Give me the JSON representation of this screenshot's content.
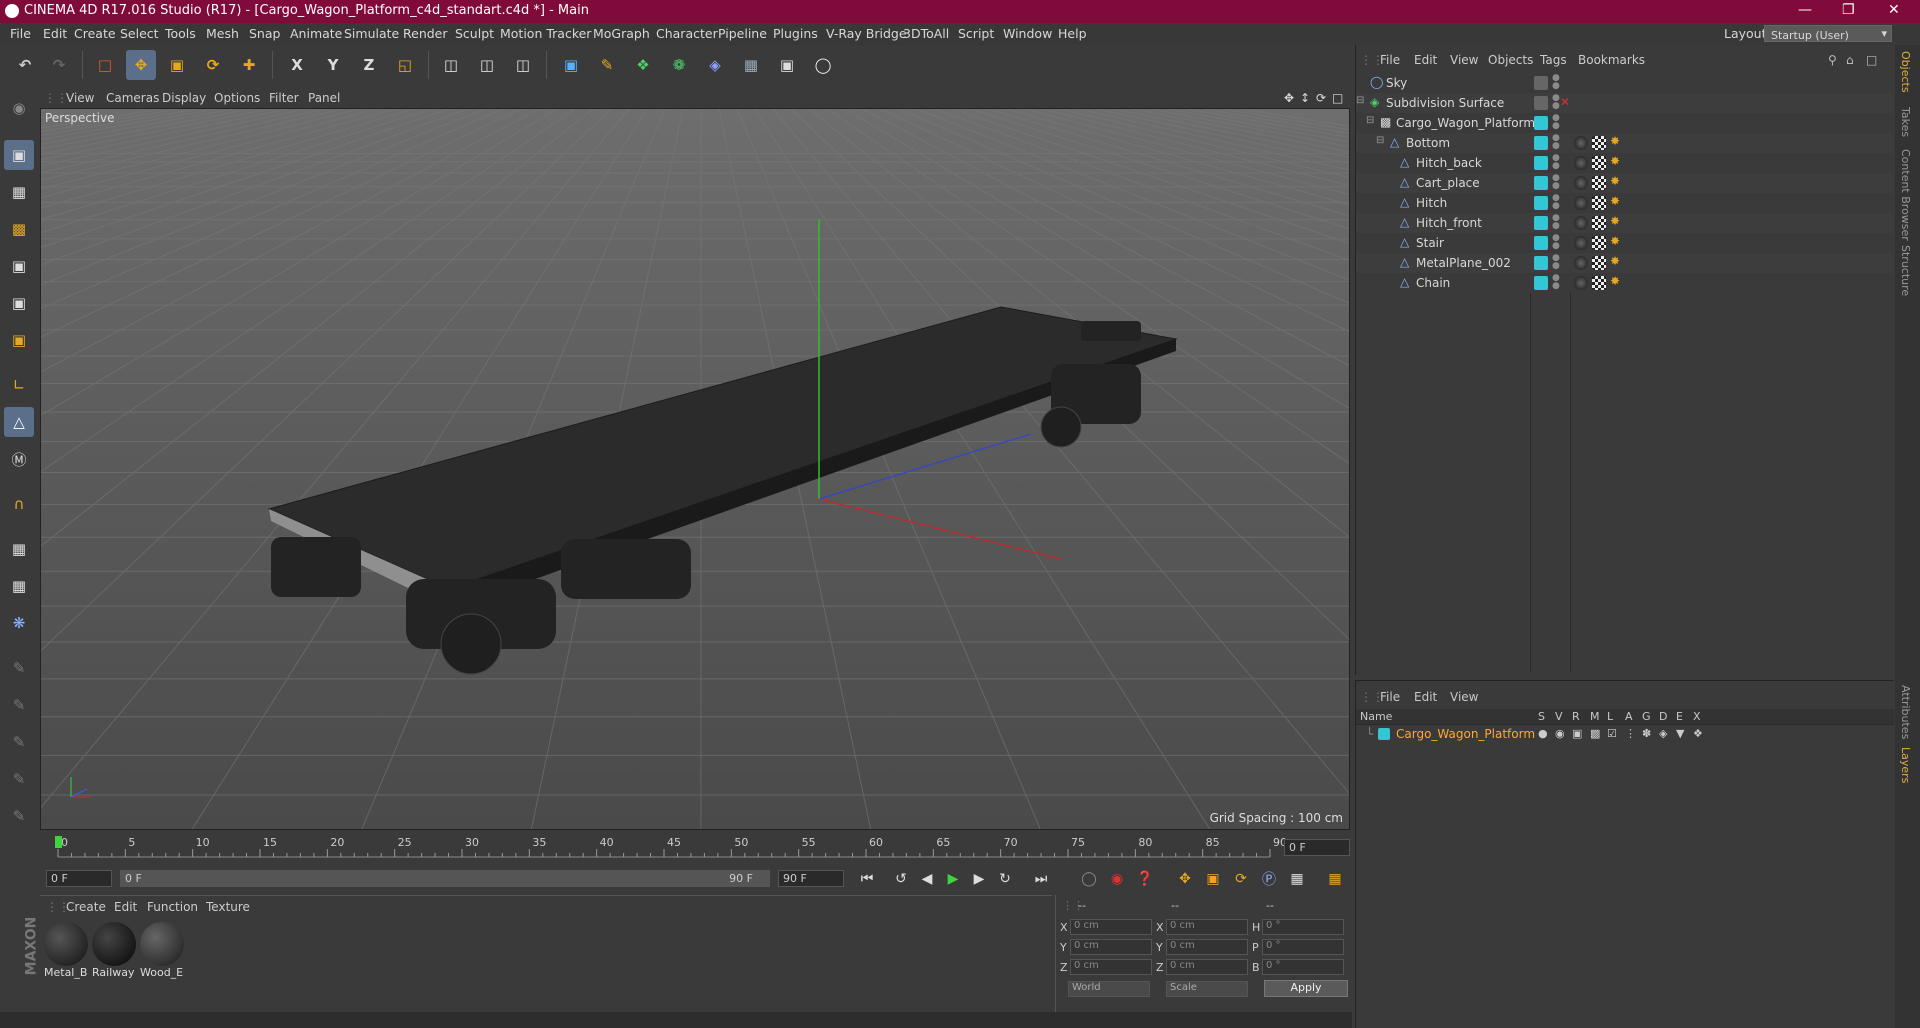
{
  "title": "CINEMA 4D R17.016 Studio (R17) - [Cargo_Wagon_Platform_c4d_standart.c4d *] - Main",
  "menu": [
    "File",
    "Edit",
    "Create",
    "Select",
    "Tools",
    "Mesh",
    "Snap",
    "Animate",
    "Simulate",
    "Render",
    "Sculpt",
    "Motion Tracker",
    "MoGraph",
    "Character",
    "Pipeline",
    "Plugins",
    "V-Ray Bridge",
    "3DToAll",
    "Script",
    "Window",
    "Help"
  ],
  "layout_label": "Layout:",
  "layout_value": "Startup (User)",
  "toolbar_axes": [
    "X",
    "Y",
    "Z"
  ],
  "viewport": {
    "menu": [
      "View",
      "Cameras",
      "Display",
      "Options",
      "Filter",
      "Panel"
    ],
    "camera": "Perspective",
    "grid_spacing": "Grid Spacing : 100 cm"
  },
  "timeline": {
    "ticks": [
      "0",
      "5",
      "10",
      "15",
      "20",
      "25",
      "30",
      "35",
      "40",
      "45",
      "50",
      "55",
      "60",
      "65",
      "70",
      "75",
      "80",
      "85",
      "90"
    ],
    "current_frame": "0 F",
    "start_field": "0 F",
    "range_start": "0 F",
    "range_end": "90 F",
    "end_field": "90 F"
  },
  "materials": {
    "menu": [
      "Create",
      "Edit",
      "Function",
      "Texture"
    ],
    "items": [
      {
        "label": "Metal_B"
      },
      {
        "label": "Railway"
      },
      {
        "label": "Wood_E"
      }
    ]
  },
  "coords": {
    "headers": [
      "--",
      "--",
      "--"
    ],
    "rows": [
      {
        "a": "X",
        "av": "0 cm",
        "b": "X",
        "bv": "0 cm",
        "c": "H",
        "cv": "0 °"
      },
      {
        "a": "Y",
        "av": "0 cm",
        "b": "Y",
        "bv": "0 cm",
        "c": "P",
        "cv": "0 °"
      },
      {
        "a": "Z",
        "av": "0 cm",
        "b": "Z",
        "bv": "0 cm",
        "c": "B",
        "cv": "0 °"
      }
    ],
    "world": "World",
    "scale": "Scale",
    "apply": "Apply"
  },
  "objects": {
    "menu": [
      "File",
      "Edit",
      "View",
      "Objects",
      "Tags",
      "Bookmarks"
    ],
    "items": [
      {
        "name": "Sky"
      },
      {
        "name": "Subdivision Surface"
      },
      {
        "name": "Cargo_Wagon_Platform"
      },
      {
        "name": "Bottom"
      },
      {
        "name": "Hitch_back"
      },
      {
        "name": "Cart_place"
      },
      {
        "name": "Hitch"
      },
      {
        "name": "Hitch_front"
      },
      {
        "name": "Stair"
      },
      {
        "name": "MetalPlane_002"
      },
      {
        "name": "Chain"
      }
    ]
  },
  "layers": {
    "menu": [
      "File",
      "Edit",
      "View"
    ],
    "name_header": "Name",
    "columns": [
      "S",
      "V",
      "R",
      "M",
      "L",
      "A",
      "G",
      "D",
      "E",
      "X"
    ],
    "items": [
      {
        "name": "Cargo_Wagon_Platform"
      }
    ]
  },
  "right_tabs": [
    "Objects",
    "Takes",
    "Content Browser",
    "Structure",
    "Attributes",
    "Layers"
  ],
  "colors": {
    "titlebar": "#800a3a",
    "layer_cyan": "#33c7d6",
    "selected_text": "#ffaa2a"
  }
}
